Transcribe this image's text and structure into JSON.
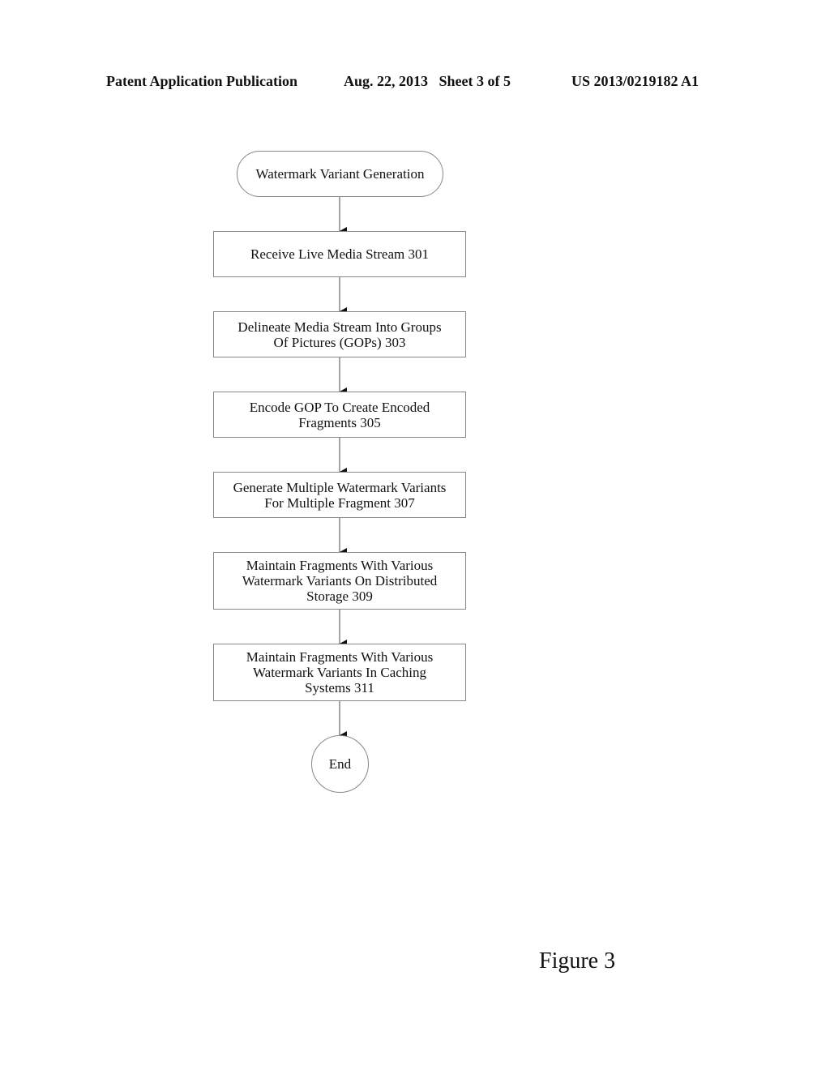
{
  "header": {
    "publication": "Patent Application Publication",
    "date_sheet": "Aug. 22, 2013   Sheet 3 of 5",
    "patent_number": "US 2013/0219182 A1"
  },
  "flowchart": {
    "start": "Watermark Variant Generation",
    "steps": [
      {
        "id": "301",
        "text": "Receive Live Media Stream 301"
      },
      {
        "id": "303",
        "text": "Delineate Media Stream Into Groups\nOf Pictures (GOPs) 303"
      },
      {
        "id": "305",
        "text": "Encode GOP To Create Encoded\nFragments 305"
      },
      {
        "id": "307",
        "text": "Generate Multiple Watermark Variants\nFor Multiple Fragment 307"
      },
      {
        "id": "309",
        "text": "Maintain Fragments With Various\nWatermark Variants On Distributed\nStorage 309"
      },
      {
        "id": "311",
        "text": "Maintain Fragments With Various\nWatermark Variants In Caching\nSystems 311"
      }
    ],
    "end": "End"
  },
  "figure_label": "Figure 3"
}
